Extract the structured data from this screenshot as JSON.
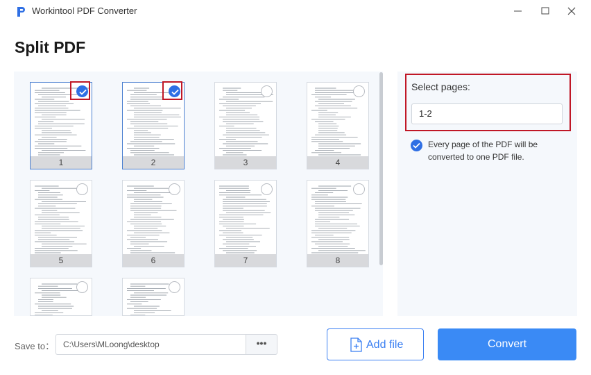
{
  "window": {
    "title": "Workintool PDF Converter"
  },
  "page": {
    "title": "Split PDF"
  },
  "thumbnails": [
    {
      "number": "1",
      "checked": true
    },
    {
      "number": "2",
      "checked": true
    },
    {
      "number": "3",
      "checked": false
    },
    {
      "number": "4",
      "checked": false
    },
    {
      "number": "5",
      "checked": false
    },
    {
      "number": "6",
      "checked": false
    },
    {
      "number": "7",
      "checked": false
    },
    {
      "number": "8",
      "checked": false
    },
    {
      "number": "",
      "checked": false
    },
    {
      "number": "",
      "checked": false
    }
  ],
  "options": {
    "select_label": "Select pages:",
    "pages_value": "1-2",
    "split_option": "Every page of the PDF will be converted to one PDF file.",
    "split_option_checked": true
  },
  "footer": {
    "save_label": "Save to：",
    "save_path": "C:\\Users\\MLoong\\desktop",
    "browse_label": "•••",
    "add_file_label": "Add file",
    "convert_label": "Convert"
  },
  "colors": {
    "accent": "#3a8af5",
    "highlight": "#c01726",
    "check": "#2f6fe4"
  },
  "icons": {
    "logo": "workintool-logo-icon",
    "add_file": "add-file-icon",
    "check": "check-icon"
  }
}
